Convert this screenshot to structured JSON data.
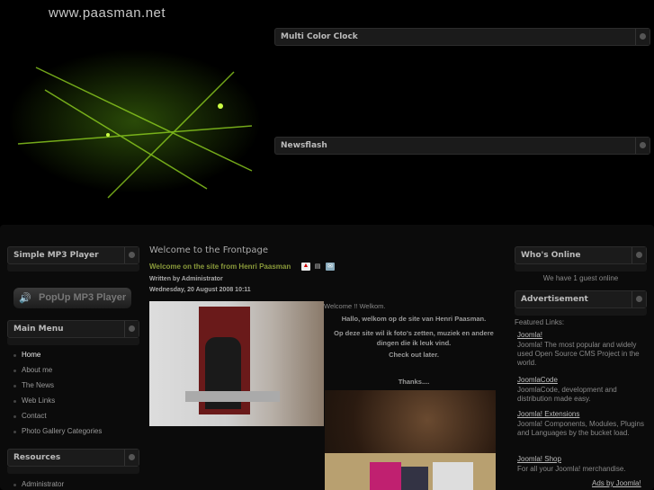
{
  "header": {
    "site_title": "www.paasman.net",
    "modules": [
      "Multi Color Clock",
      "Newsflash"
    ]
  },
  "left": {
    "mp3_title": "Simple MP3 Player",
    "popup_label": "PopUp MP3 Player",
    "menu_title": "Main Menu",
    "menu": [
      "Home",
      "About me",
      "The News",
      "Web Links",
      "Contact",
      "Photo Gallery Categories"
    ],
    "resources_title": "Resources",
    "resources": [
      "Administrator"
    ]
  },
  "content": {
    "title": "Welcome to the Frontpage",
    "subtitle": "Welcome on the site from Henri Paasman",
    "author": "Written by Administrator",
    "date": "Wednesday, 20 August 2008 10:11",
    "welcome": "Welcome !! Welkom.",
    "p1": "Hallo, welkom op de site van Henri Paasman.",
    "p2": "Op deze site wil ik foto's zetten, muziek en andere dingen die ik leuk vind.",
    "p3": "Check out later.",
    "p4": "Thanks...."
  },
  "right": {
    "online_title": "Who's Online",
    "online_text": "We have 1 guest online",
    "ad_title": "Advertisement",
    "featured": "Featured Links:",
    "links": [
      {
        "title": "Joomla!",
        "desc": "Joomla! The most popular and widely used Open Source CMS Project in the world."
      },
      {
        "title": "JoomlaCode",
        "desc": "JoomlaCode, development and distribution made easy."
      },
      {
        "title": "Joomla! Extensions",
        "desc": "Joomla! Components, Modules, Plugins and Languages by the bucket load."
      },
      {
        "title": "Joomla! Shop",
        "desc": "For all your Joomla! merchandise."
      }
    ],
    "ads_by": "Ads by Joomla!"
  }
}
